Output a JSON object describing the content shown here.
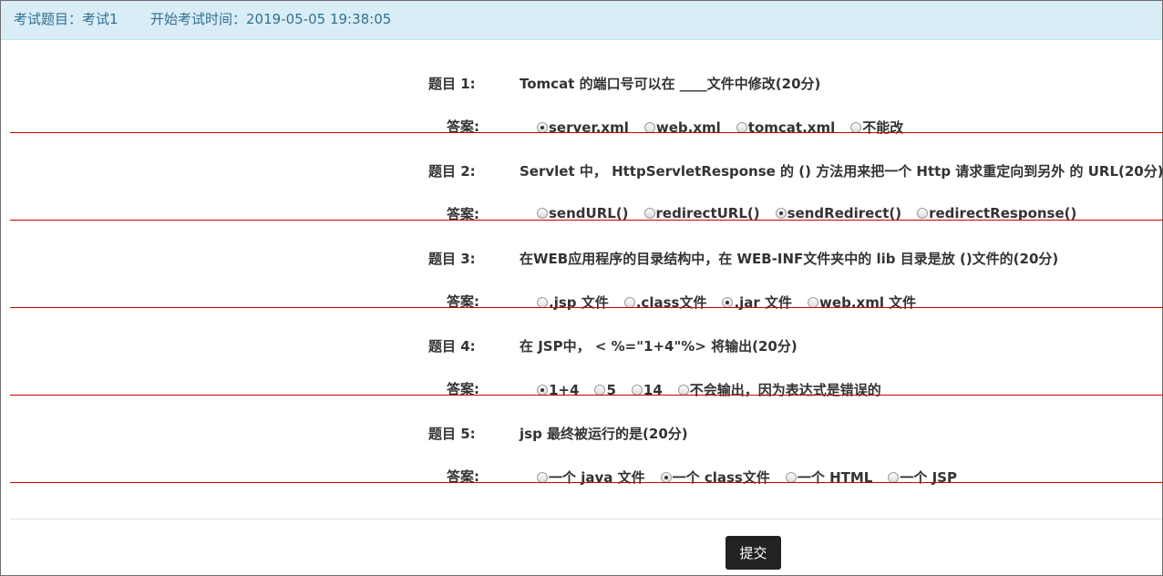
{
  "header": {
    "exam_title": "考试题目：考试1",
    "start_time": "开始考试时间：2019-05-05 19:38:05"
  },
  "questions": [
    {
      "label": "题目  1:",
      "text": "Tomcat 的端口号可以在 ____文件中修改(20分)",
      "answer_label": "答案:",
      "options": [
        "server.xml",
        "web.xml",
        "tomcat.xml",
        "不能改"
      ],
      "selected": 0
    },
    {
      "label": "题目  2:",
      "text": "Servlet 中， HttpServletResponse 的  ()  方法用来把一个 Http 请求重定向到另外 的 URL(20分)",
      "answer_label": "答案:",
      "options": [
        "sendURL()",
        "redirectURL()",
        "sendRedirect()",
        "redirectResponse()"
      ],
      "selected": 2
    },
    {
      "label": "题目  3:",
      "text": "在WEB应用程序的目录结构中，在 WEB-INF文件夹中的 lib 目录是放 ()文件的(20分)",
      "answer_label": "答案:",
      "options": [
        ".jsp 文件",
        ".class文件",
        ".jar 文件",
        "web.xml 文件"
      ],
      "selected": 2
    },
    {
      "label": "题目  4:",
      "text": "在 JSP中， < %=\"1+4\"%> 将输出(20分)",
      "answer_label": "答案:",
      "options": [
        "1+4",
        "5",
        "14",
        "不会输出，因为表达式是错误的"
      ],
      "selected": 0
    },
    {
      "label": "题目  5:",
      "text": "jsp 最终被运行的是(20分)",
      "answer_label": "答案:",
      "options": [
        "一个 java 文件",
        "一个 class文件",
        "一个 HTML",
        "一个 JSP"
      ],
      "selected": 1
    }
  ],
  "submit_label": "提交"
}
